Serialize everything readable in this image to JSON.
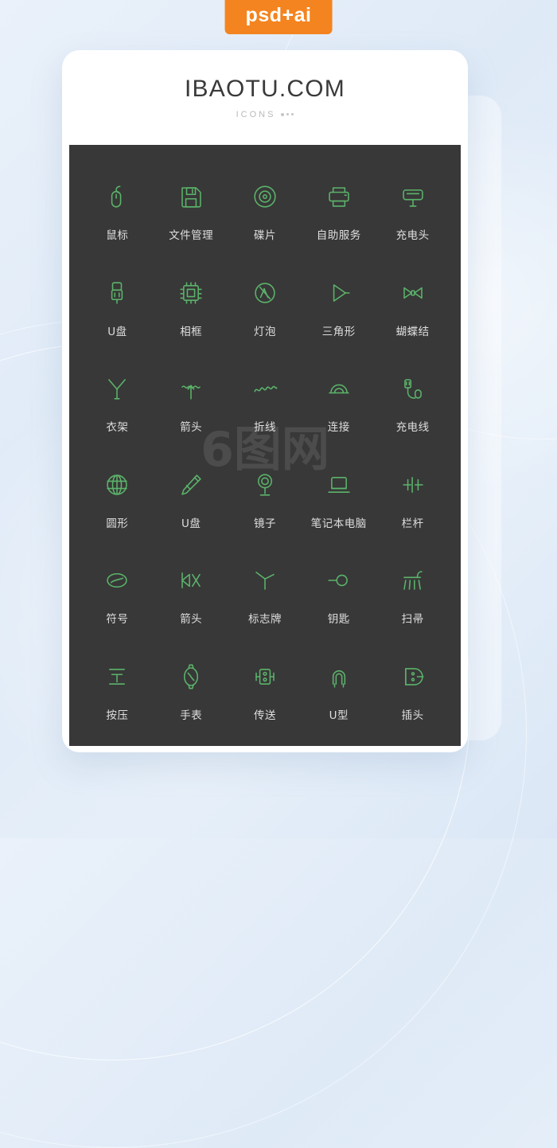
{
  "badge": {
    "label": "psd+ai",
    "color": "#f4841f"
  },
  "card": {
    "title": "IBAOTU.COM",
    "subtitle": "ICONS"
  },
  "watermark": {
    "text": "6图网"
  },
  "panel": {
    "background": "#383838",
    "icon_color": "#5bb36a",
    "label_color": "#dfdfdf",
    "icons": [
      {
        "name": "mouse-icon",
        "label": "鼠标"
      },
      {
        "name": "file-manager-icon",
        "label": "文件管理"
      },
      {
        "name": "disc-icon",
        "label": "碟片"
      },
      {
        "name": "self-service-icon",
        "label": "自助服务"
      },
      {
        "name": "charging-head-icon",
        "label": "充电头"
      },
      {
        "name": "usb-drive-icon",
        "label": "U盘"
      },
      {
        "name": "photo-frame-icon",
        "label": "相框"
      },
      {
        "name": "light-bulb-icon",
        "label": "灯泡"
      },
      {
        "name": "triangle-icon",
        "label": "三角形"
      },
      {
        "name": "bow-tie-icon",
        "label": "蝴蝶结"
      },
      {
        "name": "hanger-icon",
        "label": "衣架"
      },
      {
        "name": "arrow-icon",
        "label": "箭头"
      },
      {
        "name": "polyline-icon",
        "label": "折线"
      },
      {
        "name": "connect-icon",
        "label": "连接"
      },
      {
        "name": "charging-cable-icon",
        "label": "充电线"
      },
      {
        "name": "circle-icon",
        "label": "圆形"
      },
      {
        "name": "usb-stick-icon",
        "label": "U盘"
      },
      {
        "name": "mirror-icon",
        "label": "镜子"
      },
      {
        "name": "laptop-icon",
        "label": "笔记本电脑"
      },
      {
        "name": "railing-icon",
        "label": "栏杆"
      },
      {
        "name": "symbol-icon",
        "label": "符号"
      },
      {
        "name": "arrow-split-icon",
        "label": "箭头"
      },
      {
        "name": "signpost-icon",
        "label": "标志牌"
      },
      {
        "name": "key-icon",
        "label": "钥匙"
      },
      {
        "name": "broom-icon",
        "label": "扫帚"
      },
      {
        "name": "press-icon",
        "label": "按压"
      },
      {
        "name": "watch-icon",
        "label": "手表"
      },
      {
        "name": "conveyor-icon",
        "label": "传送"
      },
      {
        "name": "u-shape-icon",
        "label": "U型"
      },
      {
        "name": "plug-icon",
        "label": "插头"
      }
    ]
  }
}
